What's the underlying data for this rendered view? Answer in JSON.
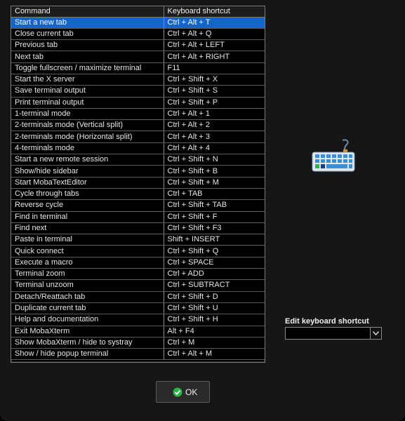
{
  "table": {
    "headers": [
      "Command",
      "Keyboard shortcut"
    ],
    "selected_row": 0,
    "rows": [
      [
        "Start a new tab",
        "Ctrl + Alt + T"
      ],
      [
        "Close current tab",
        "Ctrl + Alt + Q"
      ],
      [
        "Previous tab",
        "Ctrl + Alt + LEFT"
      ],
      [
        "Next tab",
        "Ctrl + Alt + RIGHT"
      ],
      [
        "Toggle fullscreen / maximize terminal",
        "F11"
      ],
      [
        "Start the X server",
        "Ctrl + Shift + X"
      ],
      [
        "Save terminal output",
        "Ctrl + Shift + S"
      ],
      [
        "Print terminal output",
        "Ctrl + Shift + P"
      ],
      [
        "1-terminal mode",
        "Ctrl + Alt + 1"
      ],
      [
        "2-terminals mode (Vertical split)",
        "Ctrl + Alt + 2"
      ],
      [
        "2-terminals mode (Horizontal split)",
        "Ctrl + Alt + 3"
      ],
      [
        "4-terminals mode",
        "Ctrl + Alt + 4"
      ],
      [
        "Start a new remote session",
        "Ctrl + Shift + N"
      ],
      [
        "Show/hide sidebar",
        "Ctrl + Shift + B"
      ],
      [
        "Start MobaTextEditor",
        "Ctrl + Shift + M"
      ],
      [
        "Cycle through tabs",
        "Ctrl + TAB"
      ],
      [
        "Reverse cycle",
        "Ctrl + Shift + TAB"
      ],
      [
        "Find in terminal",
        "Ctrl + Shift + F"
      ],
      [
        "Find next",
        "Ctrl + Shift + F3"
      ],
      [
        "Paste in terminal",
        "Shift + INSERT"
      ],
      [
        "Quick connect",
        "Ctrl + Shift + Q"
      ],
      [
        "Execute a macro",
        "Ctrl + SPACE"
      ],
      [
        "Terminal zoom",
        "Ctrl + ADD"
      ],
      [
        "Terminal unzoom",
        "Ctrl + SUBTRACT"
      ],
      [
        "Detach/Reattach tab",
        "Ctrl + Shift + D"
      ],
      [
        "Duplicate current tab",
        "Ctrl + Shift + U"
      ],
      [
        "Help and documentation",
        "Ctrl + Shift + H"
      ],
      [
        "Exit MobaXterm",
        "Alt + F4"
      ],
      [
        "Show MobaXterm / hide to systray",
        "Ctrl + M"
      ],
      [
        "Show / hide popup terminal",
        "Ctrl + Alt + M"
      ]
    ]
  },
  "icons": {
    "illustration": "keyboard-icon",
    "dropdown": "chevron-down-icon",
    "ok": "green-check-icon"
  },
  "edit": {
    "label": "Edit keyboard shortcut",
    "value": ""
  },
  "ok_button": {
    "label": "OK"
  },
  "colors": {
    "background": "#161616",
    "selection": "#1565c8",
    "text": "#e6e6e6",
    "ok_check": "#2fb24a"
  }
}
